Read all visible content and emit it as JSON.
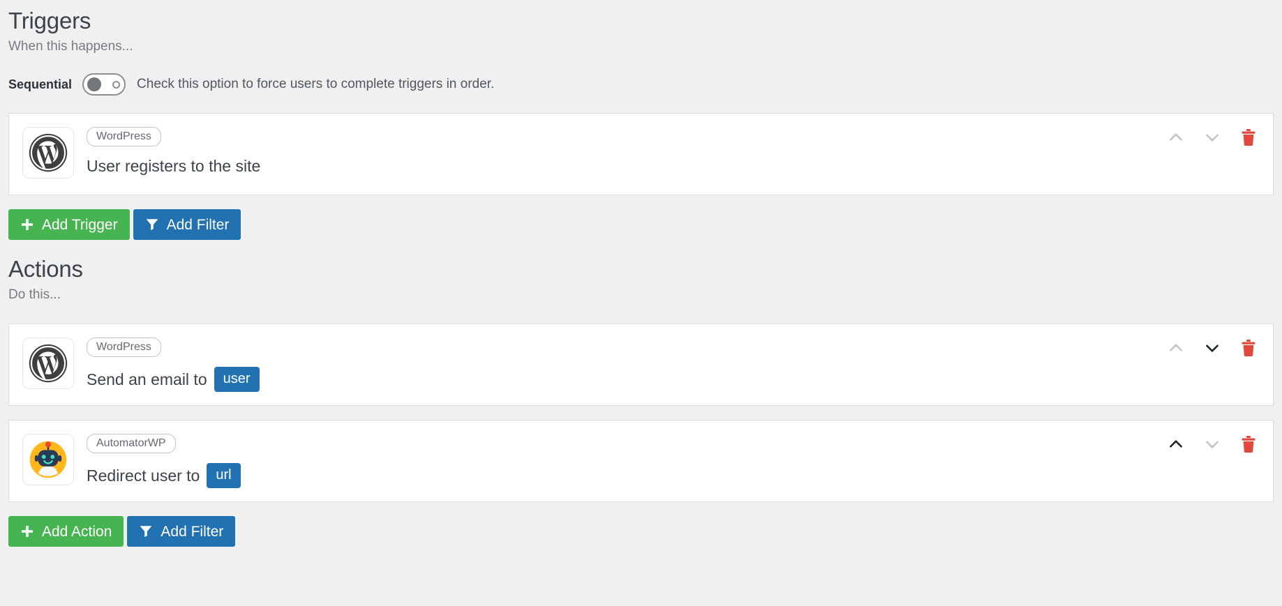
{
  "colors": {
    "page_background": "#f0f0f1",
    "card_background": "#ffffff",
    "accent_green": "#46b450",
    "accent_blue": "#2271b1",
    "danger_red": "#e0493e",
    "heading_text": "#3c434a",
    "muted_text": "#787c82"
  },
  "triggers": {
    "title": "Triggers",
    "subtitle": "When this happens...",
    "sequential": {
      "label": "Sequential",
      "toggle_state": "off",
      "toggle_icon": "toggle-off-icon",
      "description": "Check this option to force users to complete triggers in order."
    },
    "items": [
      {
        "icon": "wordpress-logo-icon",
        "integration": "WordPress",
        "sentence": "User registers to the site",
        "token": null,
        "move_up_enabled": false,
        "move_down_enabled": false
      }
    ],
    "buttons": {
      "add_label": "Add Trigger",
      "add_icon": "plus-icon",
      "filter_label": "Add Filter",
      "filter_icon": "funnel-icon"
    }
  },
  "actions": {
    "title": "Actions",
    "subtitle": "Do this...",
    "items": [
      {
        "icon": "wordpress-logo-icon",
        "integration": "WordPress",
        "sentence": "Send an email to",
        "token": "user",
        "move_up_enabled": false,
        "move_down_enabled": true
      },
      {
        "icon": "automatorwp-logo-icon",
        "integration": "AutomatorWP",
        "sentence": "Redirect user to",
        "token": "url",
        "move_up_enabled": true,
        "move_down_enabled": false
      }
    ],
    "buttons": {
      "add_label": "Add Action",
      "add_icon": "plus-icon",
      "filter_label": "Add Filter",
      "filter_icon": "funnel-icon"
    }
  },
  "row_controls": {
    "move_up_icon": "chevron-up-icon",
    "move_down_icon": "chevron-down-icon",
    "delete_icon": "trash-icon"
  }
}
